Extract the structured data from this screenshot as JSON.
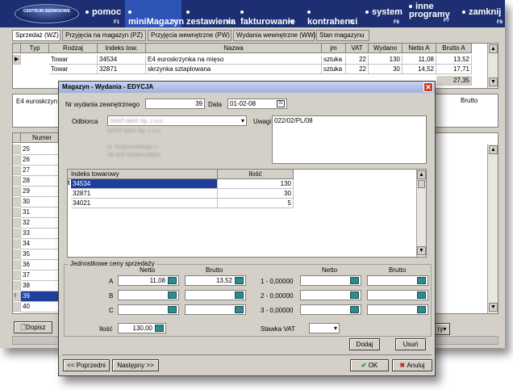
{
  "menu": {
    "logo": "CENTRUM SERWISOWE",
    "items": [
      {
        "label": "pomoc",
        "key": "F1"
      },
      {
        "label": "miniMagazyn",
        "key": "F2"
      },
      {
        "label": "zestawienia",
        "key": "F3"
      },
      {
        "label": "fakturowanie",
        "key": "F4"
      },
      {
        "label": "kontrahenci",
        "key": "F5"
      },
      {
        "label": "system",
        "key": "F6"
      },
      {
        "label": "inne programy",
        "key": "F7"
      },
      {
        "label": "zamknij",
        "key": "F8"
      }
    ]
  },
  "tabs": [
    "Sprzedaż (WZ)",
    "Przyjęcia na magazyn (PZ)",
    "Przyjęcia wewnętrzne (PW)",
    "Wydania wewnętrzne (WW)",
    "Stan magazynu"
  ],
  "top_grid": {
    "columns": [
      "Typ",
      "Rodzaj",
      "Indeks tow.",
      "Nazwa",
      "jm",
      "VAT",
      "Wydano",
      "Netto A",
      "Brutto A"
    ],
    "rows": [
      [
        "",
        "Towar",
        "34534",
        "E4 euroskrzynka na mięso",
        "sztuka",
        "22",
        "130",
        "11,08",
        "13,52"
      ],
      [
        "",
        "Towar",
        "32871",
        "skrzynka sztaplowana",
        "sztuka",
        "22",
        "30",
        "14,52",
        "17,71"
      ],
      [
        "",
        "",
        "",
        "",
        "",
        "",
        "",
        "",
        "27,35"
      ]
    ]
  },
  "detail_text": "E4 euroskrzyn",
  "detail_brutto": "Brutto",
  "bottom_grid": {
    "header": "Numer",
    "numbers": [
      "25",
      "26",
      "27",
      "28",
      "29",
      "30",
      "31",
      "32",
      "33",
      "34",
      "35",
      "36",
      "37",
      "38",
      "39",
      "40"
    ],
    "selected": "39"
  },
  "bottom_buttons": {
    "dopisz": "Dopisz",
    "dropdown_right": "ry"
  },
  "dialog": {
    "title": "Magazyn - Wydania - EDYCJA",
    "nr_label": "Nr wydania zewnętrznego",
    "nr_value": "39",
    "data_label": "Data",
    "data_value": "01-02-08",
    "odbiorca_label": "Odbiorca",
    "odbiorca_value": "SANT-MAX Sp. z o.o.",
    "address_lines": [
      "SANT-MAX Sp. z o.o.",
      "",
      "ul. Szyprowskiego 1",
      "39-400 NOWA DĘBA"
    ],
    "uwagi_label": "Uwagi",
    "uwagi_value": "022/02/PL/08",
    "items_columns": [
      "Indeks towarowy",
      "Ilość"
    ],
    "items": [
      {
        "index": "34534",
        "qty": "130"
      },
      {
        "index": "32871",
        "qty": "30"
      },
      {
        "index": "34021",
        "qty": "5"
      }
    ],
    "prices_title": "Jednostkowe ceny sprzedaży",
    "netto_label": "Netto",
    "brutto_label": "Brutto",
    "rows_left": [
      {
        "label": "A",
        "netto": "11,08",
        "brutto": "13,52"
      },
      {
        "label": "B",
        "netto": "",
        "brutto": ""
      },
      {
        "label": "C",
        "netto": "",
        "brutto": ""
      }
    ],
    "rows_right": [
      {
        "label": "1 - 0,00000",
        "netto": "",
        "brutto": ""
      },
      {
        "label": "2 - 0,00000",
        "netto": "",
        "brutto": ""
      },
      {
        "label": "3 - 0,00000",
        "netto": "",
        "brutto": ""
      }
    ],
    "ilosc_label": "Ilość",
    "ilosc_value": "130,00",
    "vat_label": "Stawka VAT",
    "vat_value": "",
    "dodaj": "Dodaj",
    "usun": "Usuń",
    "poprzedni": "<< Poprzedni",
    "nastepny": "Następny >>",
    "ok": "OK",
    "anuluj": "Anuluj"
  }
}
